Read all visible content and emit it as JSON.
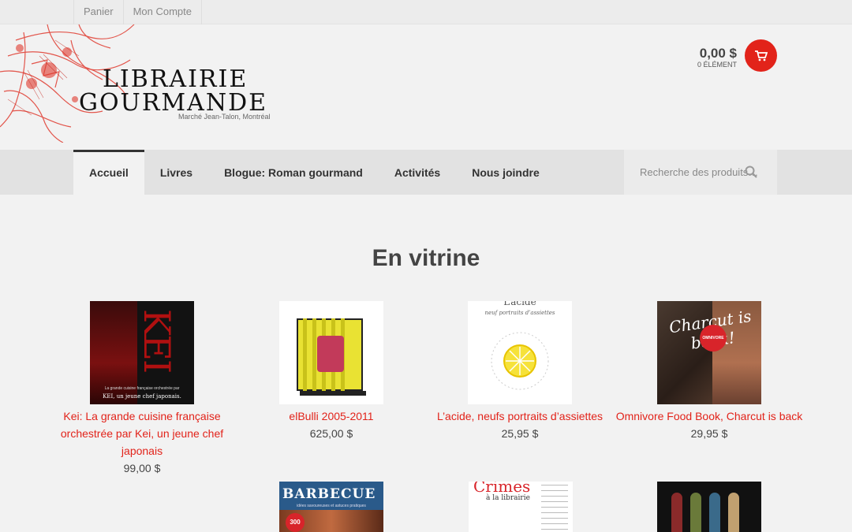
{
  "topbar": {
    "links": [
      "Panier",
      "Mon Compte"
    ]
  },
  "logo": {
    "line1": "LIBRAIRIE",
    "line2": "GOURMANDE",
    "subtitle": "Marché Jean-Talon, Montréal"
  },
  "cart": {
    "total": "0,00 $",
    "items": "0 ÉLÉMENT"
  },
  "nav": {
    "items": [
      "Accueil",
      "Livres",
      "Blogue: Roman gourmand",
      "Activités",
      "Nous joindre"
    ]
  },
  "search": {
    "placeholder": "Recherche des produits…"
  },
  "main": {
    "title": "En vitrine",
    "products": [
      {
        "name": "Kei: La grande cuisine française orchestrée par Kei, un jeune chef japonais",
        "price": "99,00 $",
        "cover_text": "KEI",
        "cover_caption_1": "La grande cuisine française orchestrée par",
        "cover_caption_2": "KEI, un jeune chef japonais."
      },
      {
        "name": "elBulli 2005-2011",
        "price": "625,00 $"
      },
      {
        "name": "L’acide, neufs portraits d’assiettes",
        "price": "25,95 $",
        "cover_title": "L’acide",
        "cover_subtitle": "neuf portraits d’assiettes"
      },
      {
        "name": "Omnivore Food Book, Charcut is back",
        "price": "29,95 $",
        "cover_text": "Charcut is back!",
        "cover_badge": "OMNIVORE"
      }
    ],
    "row2": [
      {
        "cover_title": "BARBECUE",
        "cover_subtitle": "idées savoureuses et astuces pratiques",
        "cover_badge": "300"
      },
      {
        "cover_title": "Crimes",
        "cover_subtitle": "à la librairie"
      },
      {}
    ]
  },
  "colors": {
    "accent": "#e2231a",
    "background": "#f2f2f2",
    "nav": "#e2e2e2"
  }
}
